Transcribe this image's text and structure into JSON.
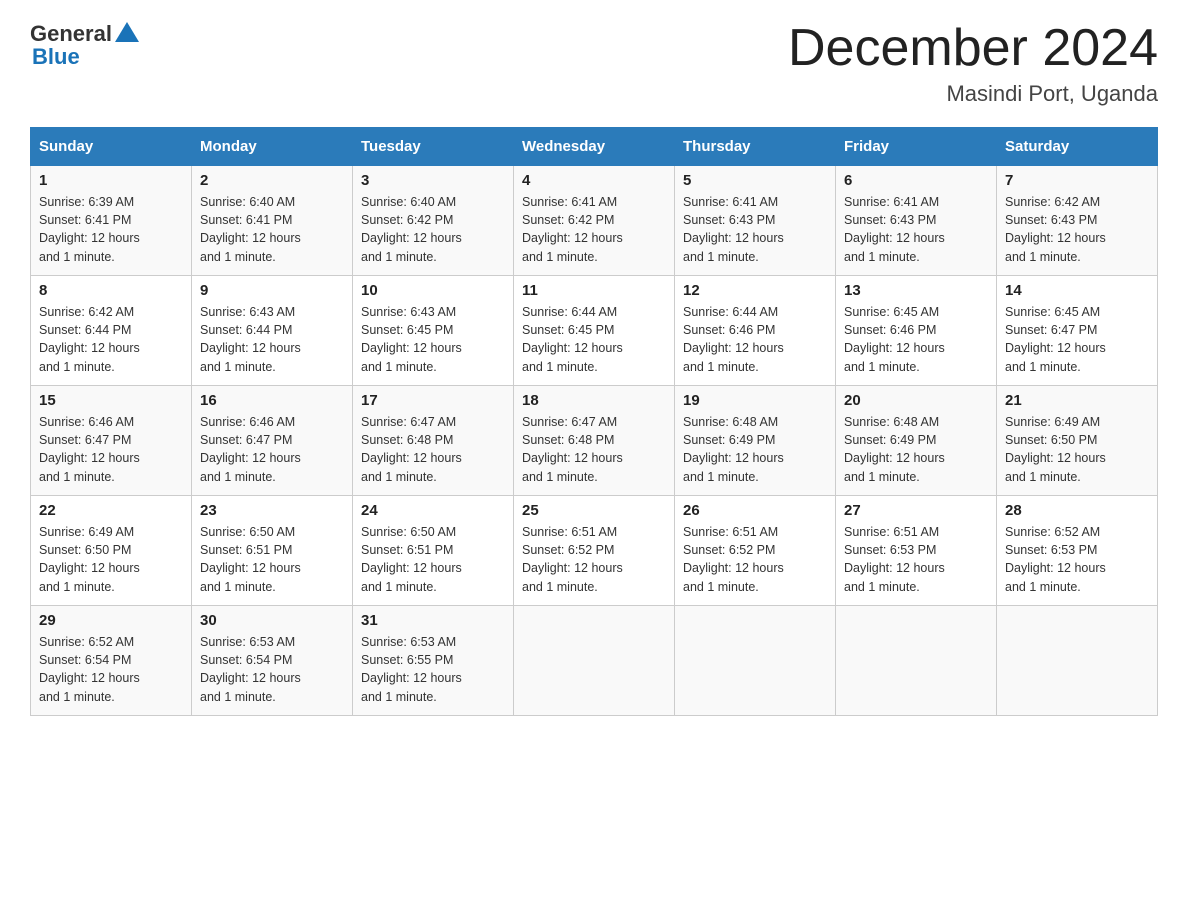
{
  "header": {
    "logo_general": "General",
    "logo_blue": "Blue",
    "month_title": "December 2024",
    "location": "Masindi Port, Uganda"
  },
  "days_of_week": [
    "Sunday",
    "Monday",
    "Tuesday",
    "Wednesday",
    "Thursday",
    "Friday",
    "Saturday"
  ],
  "weeks": [
    [
      {
        "day": "1",
        "sunrise": "6:39 AM",
        "sunset": "6:41 PM",
        "daylight": "12 hours and 1 minute."
      },
      {
        "day": "2",
        "sunrise": "6:40 AM",
        "sunset": "6:41 PM",
        "daylight": "12 hours and 1 minute."
      },
      {
        "day": "3",
        "sunrise": "6:40 AM",
        "sunset": "6:42 PM",
        "daylight": "12 hours and 1 minute."
      },
      {
        "day": "4",
        "sunrise": "6:41 AM",
        "sunset": "6:42 PM",
        "daylight": "12 hours and 1 minute."
      },
      {
        "day": "5",
        "sunrise": "6:41 AM",
        "sunset": "6:43 PM",
        "daylight": "12 hours and 1 minute."
      },
      {
        "day": "6",
        "sunrise": "6:41 AM",
        "sunset": "6:43 PM",
        "daylight": "12 hours and 1 minute."
      },
      {
        "day": "7",
        "sunrise": "6:42 AM",
        "sunset": "6:43 PM",
        "daylight": "12 hours and 1 minute."
      }
    ],
    [
      {
        "day": "8",
        "sunrise": "6:42 AM",
        "sunset": "6:44 PM",
        "daylight": "12 hours and 1 minute."
      },
      {
        "day": "9",
        "sunrise": "6:43 AM",
        "sunset": "6:44 PM",
        "daylight": "12 hours and 1 minute."
      },
      {
        "day": "10",
        "sunrise": "6:43 AM",
        "sunset": "6:45 PM",
        "daylight": "12 hours and 1 minute."
      },
      {
        "day": "11",
        "sunrise": "6:44 AM",
        "sunset": "6:45 PM",
        "daylight": "12 hours and 1 minute."
      },
      {
        "day": "12",
        "sunrise": "6:44 AM",
        "sunset": "6:46 PM",
        "daylight": "12 hours and 1 minute."
      },
      {
        "day": "13",
        "sunrise": "6:45 AM",
        "sunset": "6:46 PM",
        "daylight": "12 hours and 1 minute."
      },
      {
        "day": "14",
        "sunrise": "6:45 AM",
        "sunset": "6:47 PM",
        "daylight": "12 hours and 1 minute."
      }
    ],
    [
      {
        "day": "15",
        "sunrise": "6:46 AM",
        "sunset": "6:47 PM",
        "daylight": "12 hours and 1 minute."
      },
      {
        "day": "16",
        "sunrise": "6:46 AM",
        "sunset": "6:47 PM",
        "daylight": "12 hours and 1 minute."
      },
      {
        "day": "17",
        "sunrise": "6:47 AM",
        "sunset": "6:48 PM",
        "daylight": "12 hours and 1 minute."
      },
      {
        "day": "18",
        "sunrise": "6:47 AM",
        "sunset": "6:48 PM",
        "daylight": "12 hours and 1 minute."
      },
      {
        "day": "19",
        "sunrise": "6:48 AM",
        "sunset": "6:49 PM",
        "daylight": "12 hours and 1 minute."
      },
      {
        "day": "20",
        "sunrise": "6:48 AM",
        "sunset": "6:49 PM",
        "daylight": "12 hours and 1 minute."
      },
      {
        "day": "21",
        "sunrise": "6:49 AM",
        "sunset": "6:50 PM",
        "daylight": "12 hours and 1 minute."
      }
    ],
    [
      {
        "day": "22",
        "sunrise": "6:49 AM",
        "sunset": "6:50 PM",
        "daylight": "12 hours and 1 minute."
      },
      {
        "day": "23",
        "sunrise": "6:50 AM",
        "sunset": "6:51 PM",
        "daylight": "12 hours and 1 minute."
      },
      {
        "day": "24",
        "sunrise": "6:50 AM",
        "sunset": "6:51 PM",
        "daylight": "12 hours and 1 minute."
      },
      {
        "day": "25",
        "sunrise": "6:51 AM",
        "sunset": "6:52 PM",
        "daylight": "12 hours and 1 minute."
      },
      {
        "day": "26",
        "sunrise": "6:51 AM",
        "sunset": "6:52 PM",
        "daylight": "12 hours and 1 minute."
      },
      {
        "day": "27",
        "sunrise": "6:51 AM",
        "sunset": "6:53 PM",
        "daylight": "12 hours and 1 minute."
      },
      {
        "day": "28",
        "sunrise": "6:52 AM",
        "sunset": "6:53 PM",
        "daylight": "12 hours and 1 minute."
      }
    ],
    [
      {
        "day": "29",
        "sunrise": "6:52 AM",
        "sunset": "6:54 PM",
        "daylight": "12 hours and 1 minute."
      },
      {
        "day": "30",
        "sunrise": "6:53 AM",
        "sunset": "6:54 PM",
        "daylight": "12 hours and 1 minute."
      },
      {
        "day": "31",
        "sunrise": "6:53 AM",
        "sunset": "6:55 PM",
        "daylight": "12 hours and 1 minute."
      },
      null,
      null,
      null,
      null
    ]
  ],
  "labels": {
    "sunrise": "Sunrise:",
    "sunset": "Sunset:",
    "daylight": "Daylight:"
  }
}
